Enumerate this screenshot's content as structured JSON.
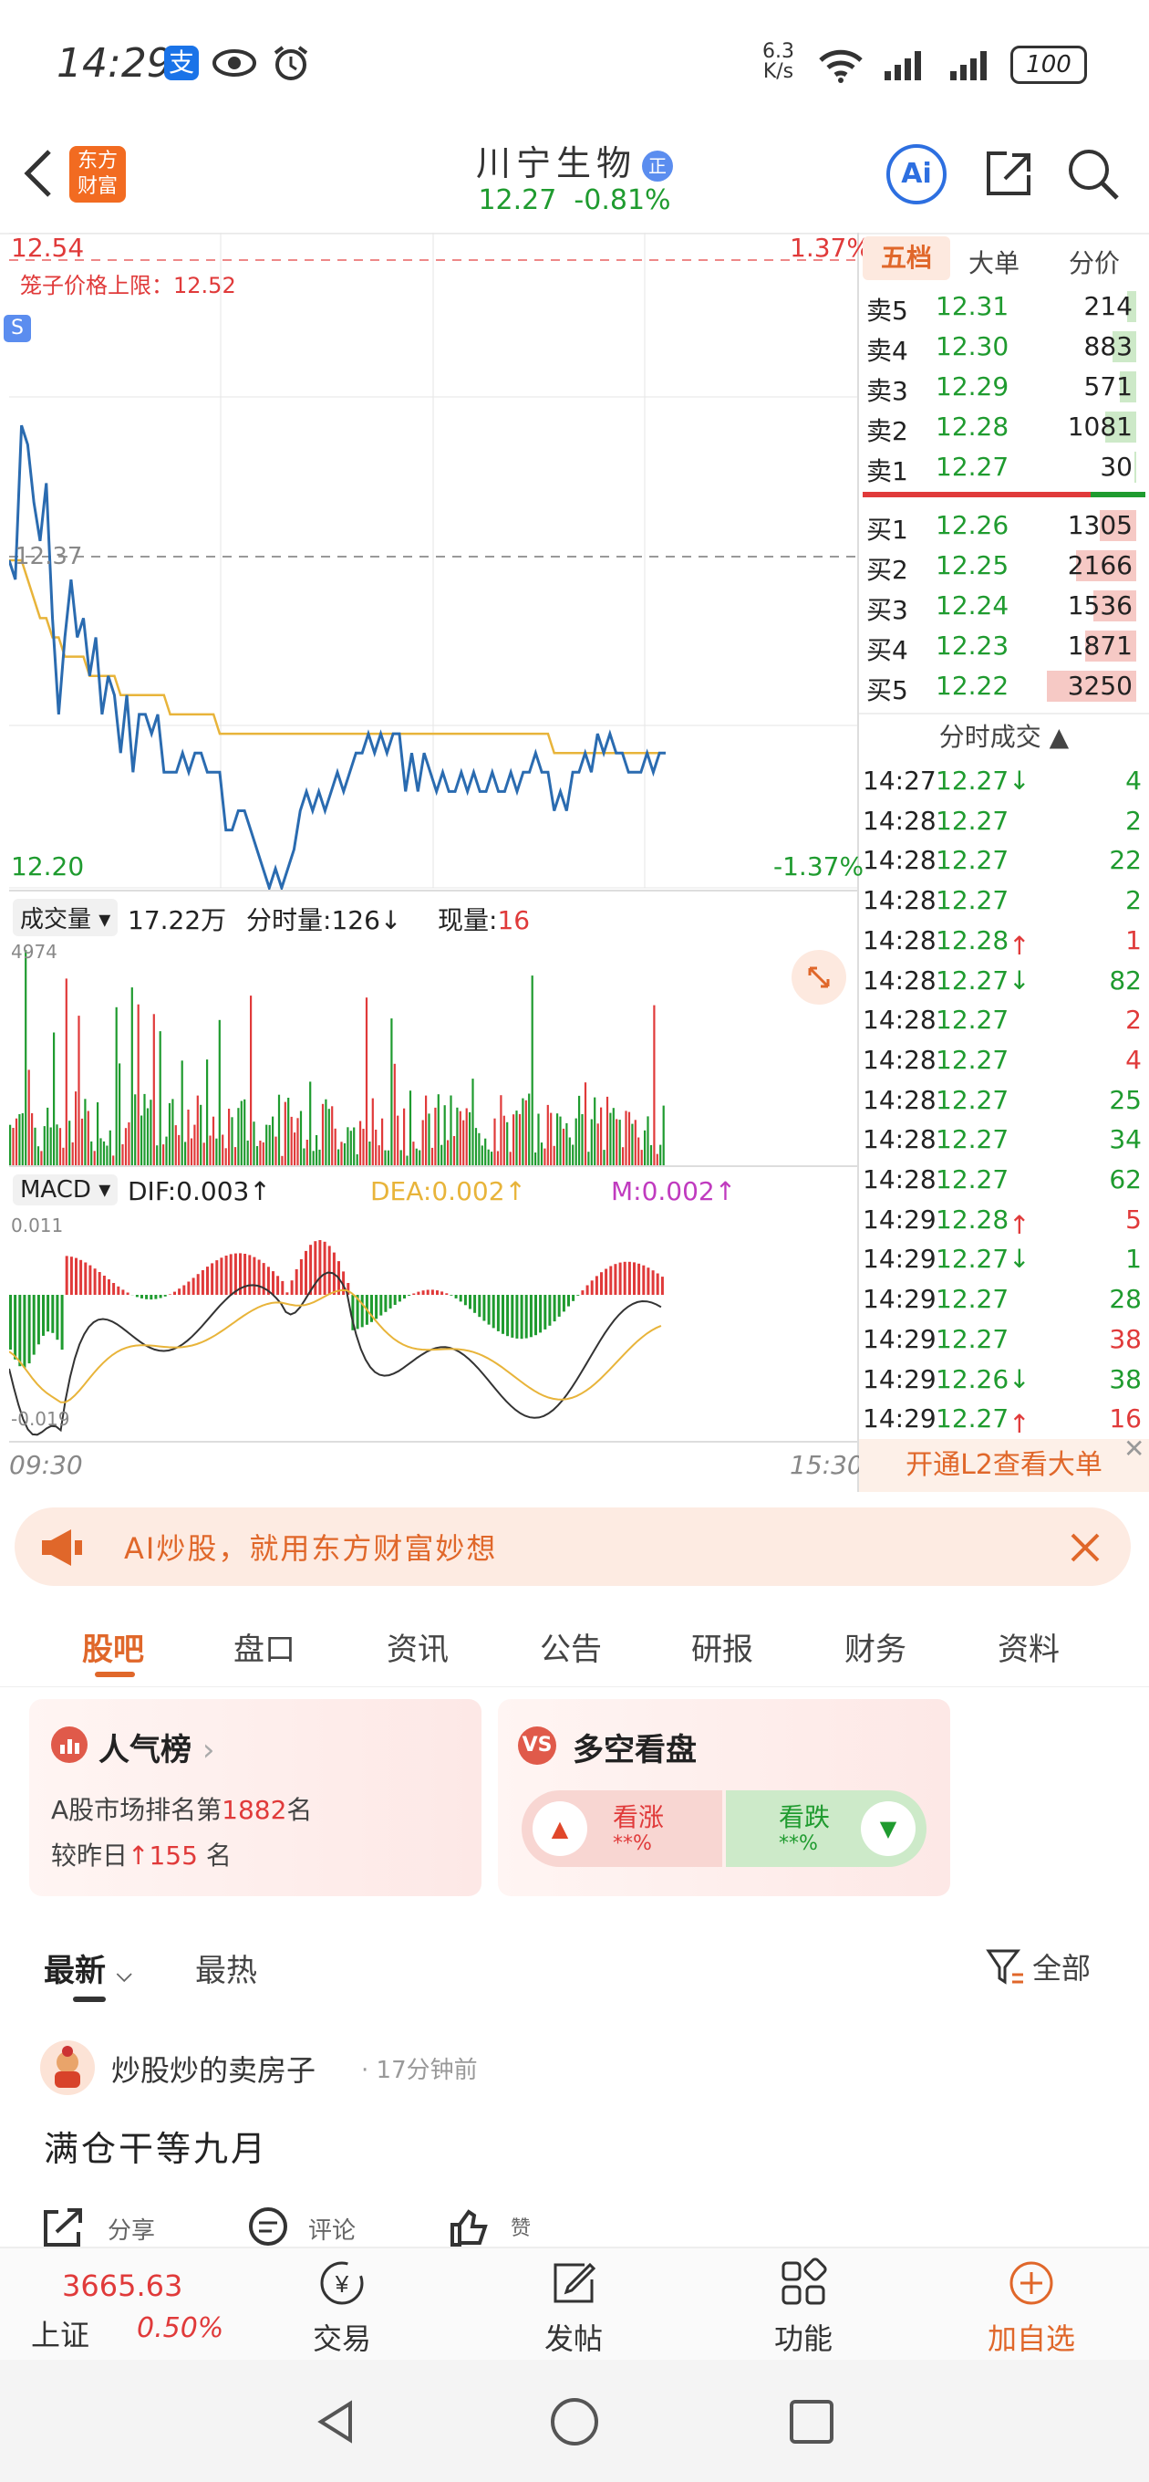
{
  "status": {
    "time": "14:29",
    "speed_top": "6.3",
    "speed_unit": "K/s",
    "wifi_6": "6",
    "battery": "100"
  },
  "header": {
    "back": "back",
    "logo_line1": "东方",
    "logo_line2": "财富",
    "name": "川宁生物",
    "badge": "正",
    "price": "12.27",
    "change": "-0.81%",
    "ai": "Ai"
  },
  "chart": {
    "top_price": "12.54",
    "top_pct": "1.37%",
    "limit_label": "笼子价格上限：",
    "limit_value": "12.52",
    "ref_price": "12.37",
    "bottom_price": "12.20",
    "bottom_pct": "-1.37%",
    "vol_tab": "成交量",
    "vol_total": "17.22万",
    "vol_cur_label": "分时量:",
    "vol_cur": "126",
    "vol_now_label": "现量:",
    "vol_now": "16",
    "vol_max": "4974",
    "macd_tab": "MACD",
    "dif": "DIF:0.003",
    "dea": "DEA:0.002",
    "m": "M:0.002",
    "macd_top": "0.011",
    "macd_bottom": "-0.019",
    "time_start": "09:30",
    "time_end": "15:30",
    "chart_data": {
      "type": "line",
      "price_range": [
        12.2,
        12.54
      ],
      "price": [
        12.37,
        12.36,
        12.44,
        12.43,
        12.4,
        12.38,
        12.41,
        12.34,
        12.29,
        12.33,
        12.36,
        12.33,
        12.34,
        12.31,
        12.33,
        12.29,
        12.31,
        12.3,
        12.27,
        12.3,
        12.26,
        12.29,
        12.29,
        12.28,
        12.29,
        12.26,
        12.26,
        12.26,
        12.27,
        12.26,
        12.27,
        12.27,
        12.26,
        12.26,
        12.26,
        12.23,
        12.23,
        12.24,
        12.24,
        12.23,
        12.22,
        12.21,
        12.2,
        12.21,
        12.2,
        12.21,
        12.22,
        12.24,
        12.25,
        12.24,
        12.25,
        12.24,
        12.25,
        12.26,
        12.25,
        12.26,
        12.27,
        12.27,
        12.28,
        12.27,
        12.28,
        12.27,
        12.28,
        12.28,
        12.25,
        12.27,
        12.25,
        12.27,
        12.26,
        12.25,
        12.26,
        12.25,
        12.25,
        12.26,
        12.25,
        12.26,
        12.25,
        12.25,
        12.26,
        12.25,
        12.25,
        12.26,
        12.25,
        12.26,
        12.26,
        12.27,
        12.26,
        12.26,
        12.24,
        12.25,
        12.24,
        12.26,
        12.26,
        12.27,
        12.26,
        12.28,
        12.27,
        12.28,
        12.27,
        12.27,
        12.26,
        12.26,
        12.26,
        12.27,
        12.26,
        12.27,
        12.27
      ],
      "avg": [
        12.37,
        12.37,
        12.37,
        12.36,
        12.35,
        12.34,
        12.34,
        12.33,
        12.33,
        12.32,
        12.32,
        12.32,
        12.32,
        12.31,
        12.31,
        12.31,
        12.31,
        12.31,
        12.3,
        12.3,
        12.3,
        12.3,
        12.3,
        12.3,
        12.3,
        12.3,
        12.29,
        12.29,
        12.29,
        12.29,
        12.29,
        12.29,
        12.29,
        12.29,
        12.28,
        12.28,
        12.28,
        12.28,
        12.28,
        12.28,
        12.28,
        12.28,
        12.28,
        12.28,
        12.28,
        12.28,
        12.28,
        12.28,
        12.28,
        12.28,
        12.28,
        12.28,
        12.28,
        12.28,
        12.28,
        12.28,
        12.28,
        12.28,
        12.28,
        12.28,
        12.28,
        12.28,
        12.28,
        12.28,
        12.28,
        12.28,
        12.28,
        12.28,
        12.28,
        12.28,
        12.28,
        12.28,
        12.28,
        12.28,
        12.28,
        12.28,
        12.28,
        12.28,
        12.28,
        12.28,
        12.28,
        12.28,
        12.28,
        12.28,
        12.28,
        12.28,
        12.28,
        12.28,
        12.27,
        12.27,
        12.27,
        12.27,
        12.27,
        12.27,
        12.27,
        12.27,
        12.27,
        12.27,
        12.27,
        12.27,
        12.27,
        12.27,
        12.27,
        12.27,
        12.27,
        12.27,
        12.27
      ]
    }
  },
  "orderbook": {
    "tabs": [
      "五档",
      "大单",
      "分价"
    ],
    "asks": [
      {
        "label": "卖5",
        "price": "12.31",
        "vol": "214",
        "bar": 0.08
      },
      {
        "label": "卖4",
        "price": "12.30",
        "vol": "883",
        "bar": 0.22
      },
      {
        "label": "卖3",
        "price": "12.29",
        "vol": "571",
        "bar": 0.15
      },
      {
        "label": "卖2",
        "price": "12.28",
        "vol": "1081",
        "bar": 0.28
      },
      {
        "label": "卖1",
        "price": "12.27",
        "vol": "30",
        "bar": 0.02
      }
    ],
    "bids": [
      {
        "label": "买1",
        "price": "12.26",
        "vol": "1305",
        "bar": 0.33
      },
      {
        "label": "买2",
        "price": "12.25",
        "vol": "2166",
        "bar": 0.55
      },
      {
        "label": "买3",
        "price": "12.24",
        "vol": "1536",
        "bar": 0.39
      },
      {
        "label": "买4",
        "price": "12.23",
        "vol": "1871",
        "bar": 0.47
      },
      {
        "label": "买5",
        "price": "12.22",
        "vol": "3250",
        "bar": 0.82
      }
    ],
    "ticks_title": "分时成交",
    "ticks": [
      {
        "t": "14:27",
        "p": "12.27↓",
        "v": "4",
        "pc": "green",
        "vc": "green"
      },
      {
        "t": "14:28",
        "p": "12.27",
        "v": "2",
        "pc": "green",
        "vc": "green"
      },
      {
        "t": "14:28",
        "p": "12.27",
        "v": "22",
        "pc": "green",
        "vc": "green"
      },
      {
        "t": "14:28",
        "p": "12.27",
        "v": "2",
        "pc": "green",
        "vc": "green"
      },
      {
        "t": "14:28",
        "p": "12.28↑",
        "v": "1",
        "pc": "green",
        "vc": "red"
      },
      {
        "t": "14:28",
        "p": "12.27↓",
        "v": "82",
        "pc": "green",
        "vc": "green"
      },
      {
        "t": "14:28",
        "p": "12.27",
        "v": "2",
        "pc": "green",
        "vc": "red"
      },
      {
        "t": "14:28",
        "p": "12.27",
        "v": "4",
        "pc": "green",
        "vc": "red"
      },
      {
        "t": "14:28",
        "p": "12.27",
        "v": "25",
        "pc": "green",
        "vc": "green"
      },
      {
        "t": "14:28",
        "p": "12.27",
        "v": "34",
        "pc": "green",
        "vc": "green"
      },
      {
        "t": "14:28",
        "p": "12.27",
        "v": "62",
        "pc": "green",
        "vc": "green"
      },
      {
        "t": "14:29",
        "p": "12.28↑",
        "v": "5",
        "pc": "green",
        "vc": "red"
      },
      {
        "t": "14:29",
        "p": "12.27↓",
        "v": "1",
        "pc": "green",
        "vc": "green"
      },
      {
        "t": "14:29",
        "p": "12.27",
        "v": "28",
        "pc": "green",
        "vc": "green"
      },
      {
        "t": "14:29",
        "p": "12.27",
        "v": "38",
        "pc": "green",
        "vc": "red"
      },
      {
        "t": "14:29",
        "p": "12.26↓",
        "v": "38",
        "pc": "green",
        "vc": "green"
      },
      {
        "t": "14:29",
        "p": "12.27↑",
        "v": "16",
        "pc": "green",
        "vc": "red"
      }
    ],
    "l2": "开通L2查看大单"
  },
  "banner": {
    "text": "AI炒股，就用东方财富妙想"
  },
  "tabs": [
    "股吧",
    "盘口",
    "资讯",
    "公告",
    "研报",
    "财务",
    "资料"
  ],
  "popular": {
    "title": "人气榜",
    "rank_pre": "A股市场排名第",
    "rank": "1882",
    "rank_suf": "名",
    "change_pre": "较昨日",
    "change": "155",
    "change_suf": "名"
  },
  "vs": {
    "title": "多空看盘",
    "up": "看涨",
    "down": "看跌",
    "up_val": "**%",
    "down_val": "**%"
  },
  "feed_tabs": {
    "latest": "最新",
    "hot": "最热",
    "filter": "全部"
  },
  "post": {
    "author": "炒股炒的卖房子",
    "time": "17分钟前",
    "content": "满仓干等九月",
    "share": "分享",
    "comment": "评论",
    "like": "赞"
  },
  "bottom": {
    "index_val": "3665.63",
    "index_name": "上证",
    "index_pct": "0.50%",
    "trade": "交易",
    "post": "发帖",
    "func": "功能",
    "add": "加自选"
  },
  "colors": {
    "red": "#e03a3a",
    "green": "#1f9b2f",
    "orange": "#e0672a",
    "avg_line": "#e8b43a",
    "price_line": "#2a6bb0"
  }
}
